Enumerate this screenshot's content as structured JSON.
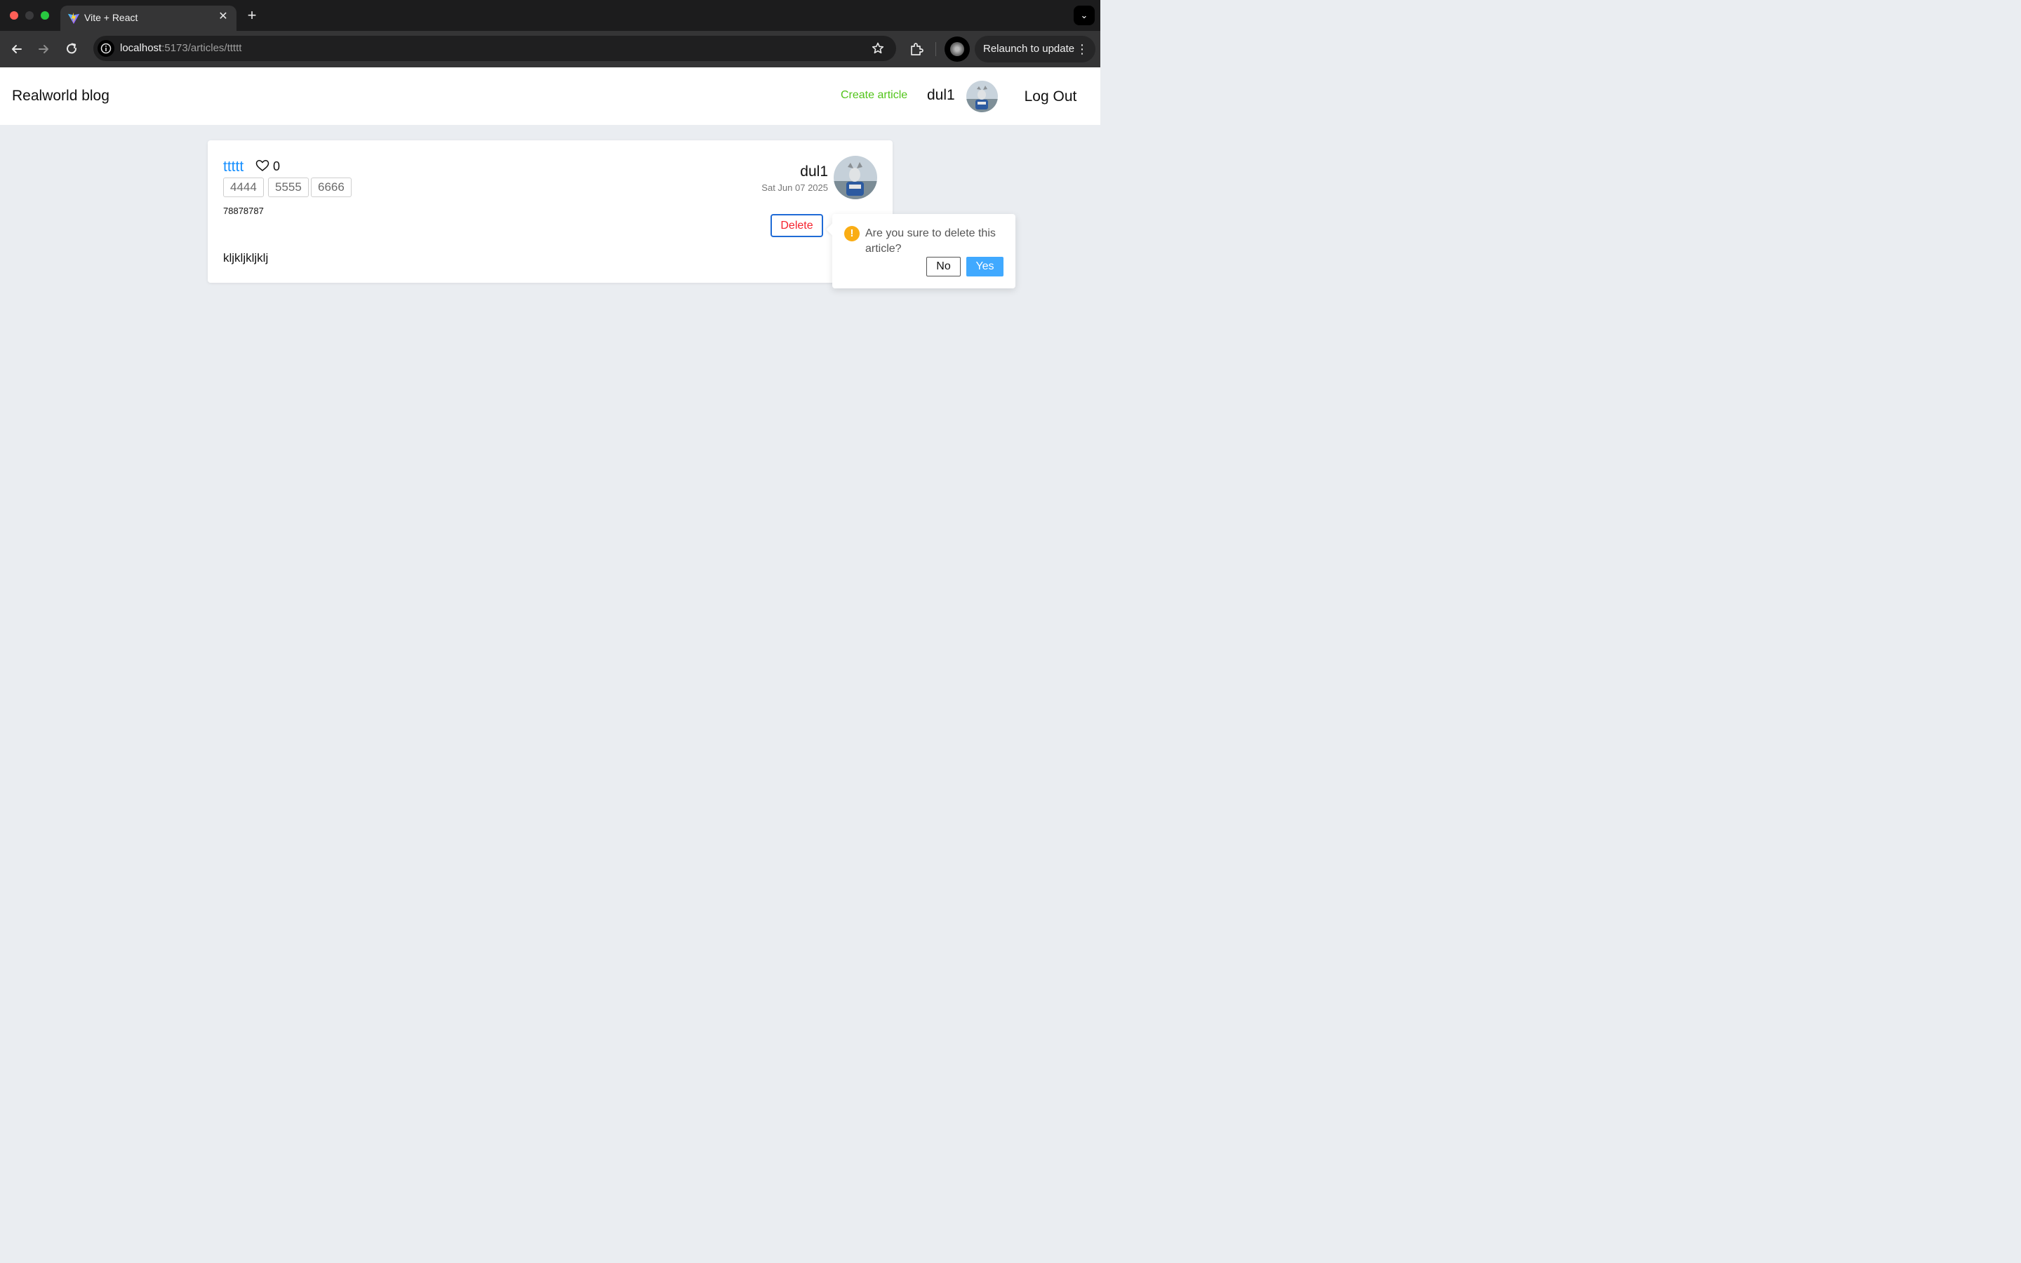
{
  "browser": {
    "tab_title": "Vite + React",
    "tab_close_glyph": "✕",
    "new_tab_glyph": "+",
    "url_host": "localhost",
    "url_path": ":5173/articles/ttttt",
    "relaunch_label": "Relaunch to update",
    "relaunch_menu_glyph": "⋮",
    "tab_menu_glyph": "⌄",
    "icons": [
      "back-arrow-icon",
      "forward-arrow-icon",
      "reload-icon",
      "site-info-icon",
      "bookmark-star-icon",
      "extensions-icon",
      "profile-avatar"
    ]
  },
  "header": {
    "logo": "Realworld blog",
    "create_article": "Create article",
    "username": "dul1",
    "logout": "Log Out"
  },
  "article": {
    "title": "ttttt",
    "likes": "0",
    "tags": [
      "4444",
      "5555",
      "6666"
    ],
    "description": "78878787",
    "body": "kljkljkljklj",
    "author": "dul1",
    "date": "Sat Jun 07 2025",
    "delete_label": "Delete"
  },
  "popconfirm": {
    "icon": "!",
    "message": "Are you sure to delete this article?",
    "no_label": "No",
    "yes_label": "Yes"
  },
  "colors": {
    "page_bg": "#eaedf1",
    "link_blue": "#1890ff",
    "create_green": "#52c41a",
    "delete_red": "#f5222d",
    "warning_yellow": "#faad14",
    "yes_blue": "#40a9ff"
  }
}
